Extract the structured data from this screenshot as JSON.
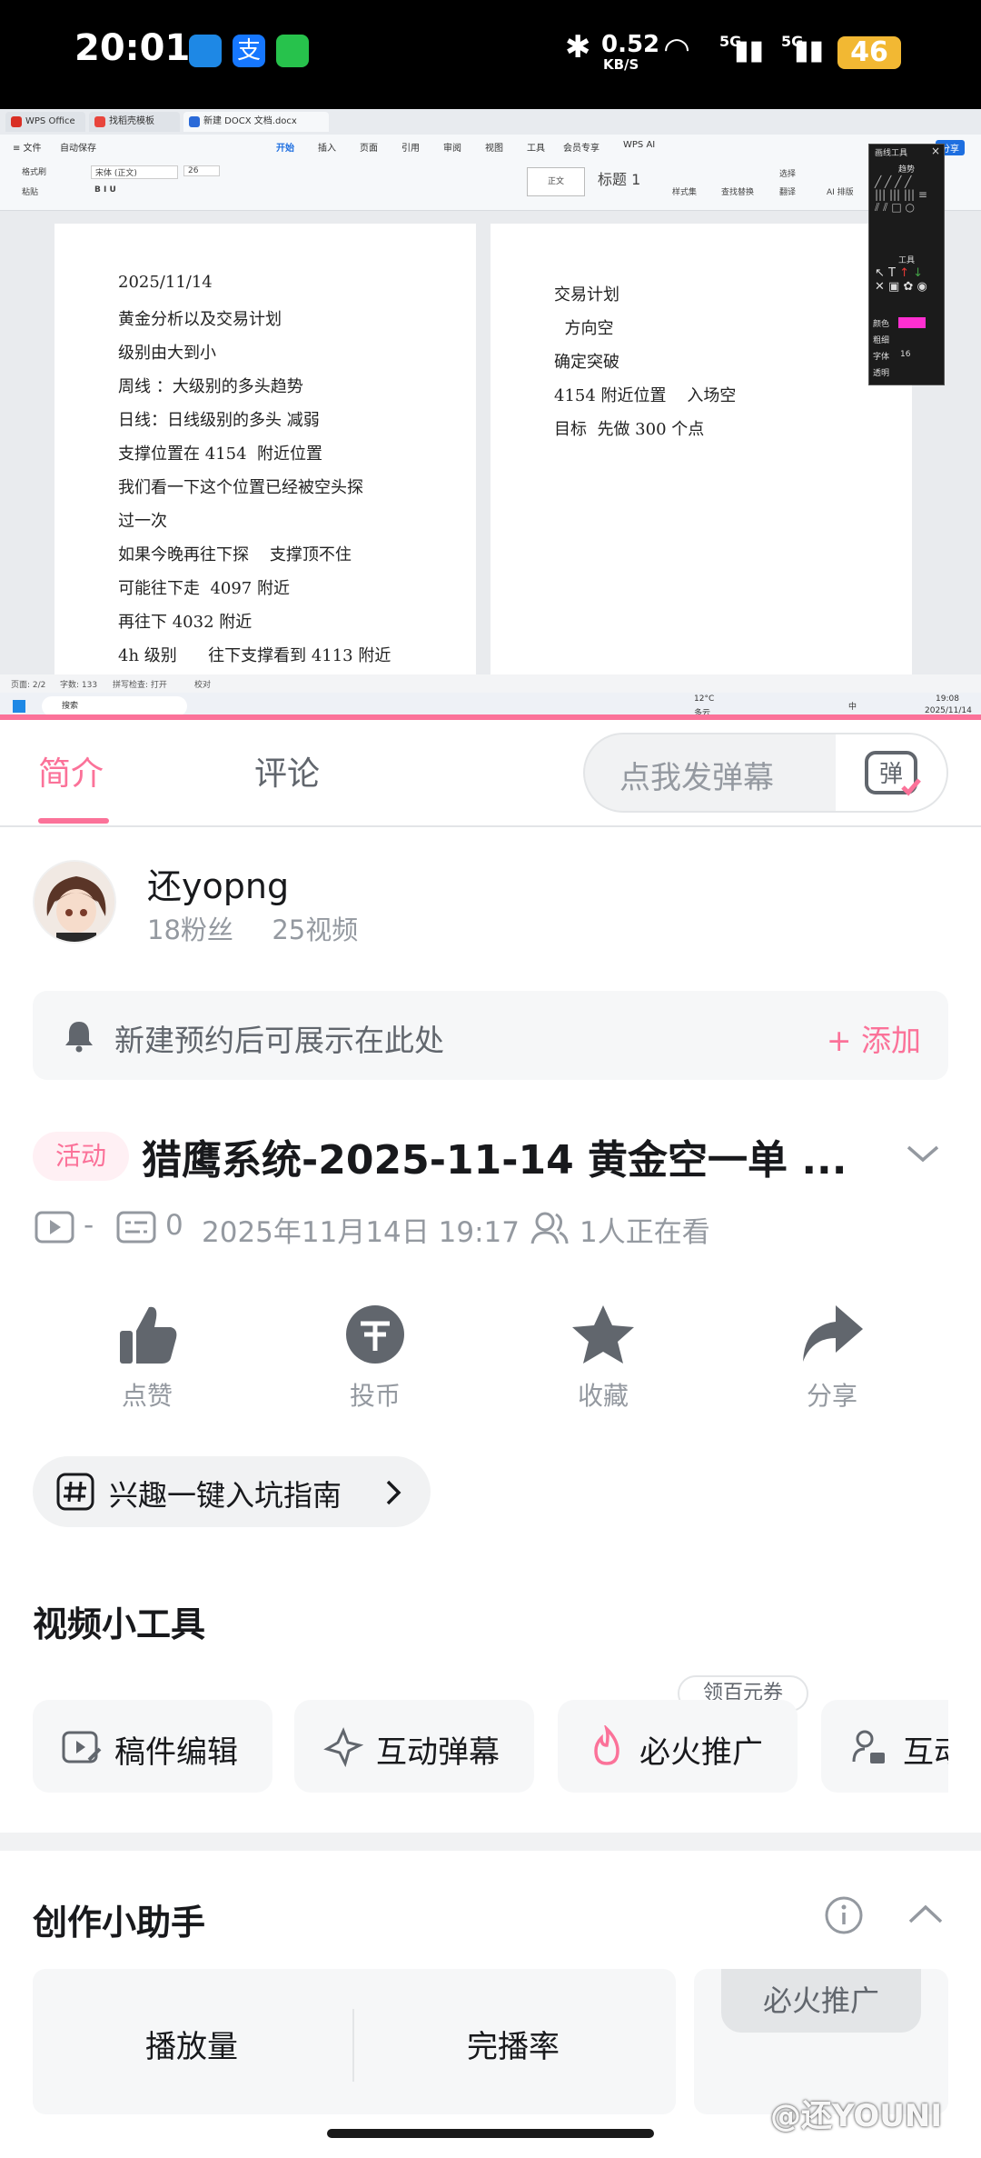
{
  "status_bar": {
    "time": "20:01",
    "net_speed_value": "0.52",
    "net_speed_unit": "KB/S",
    "signal1": "5G",
    "signal2": "5G",
    "battery": "46"
  },
  "wps": {
    "tabs": [
      "WPS Office",
      "找稻壳模板",
      "新建 DOCX 文档.docx"
    ],
    "menu_left": [
      "≡ 文件",
      "自动保存"
    ],
    "menu": [
      "开始",
      "插入",
      "页面",
      "引用",
      "审阅",
      "视图",
      "工具",
      "会员专享",
      "WPS AI"
    ],
    "share": "分享",
    "ribbon": {
      "format_painter": "格式刷",
      "paste": "粘贴",
      "font": "宋体 (正文)",
      "size": "26",
      "style_normal": "正文",
      "style_h1": "标题 1",
      "styles": "样式集",
      "find": "查找替换",
      "select": "选择",
      "translate": "翻译",
      "ai_layout": "AI 排版"
    },
    "page1_lines": [
      "2025/11/14",
      "黄金分析以及交易计划",
      "级别由大到小",
      "周线 ：大级别的多头趋势",
      "日线：日线级别的多头 减弱",
      "支撑位置在 4154  附近位置",
      "我们看一下这个位置已经被空头探",
      "过一次",
      "如果今晚再往下探    支撑顶不住",
      "可能往下走  4097 附近",
      "再往下 4032 附近",
      "4h 级别      往下支撑看到 4113 附近"
    ],
    "page2_lines": [
      "交易计划",
      "  方向空",
      "确定突破",
      "4154 附近位置    入场空",
      "目标  先做 300 个点"
    ],
    "status": {
      "page": "页面: 2/2",
      "words": "字数: 133",
      "spell": "拼写检查: 打开",
      "proof": "校对"
    },
    "taskbar": {
      "search": "搜索",
      "weather_temp": "12°C",
      "weather_desc": "多云",
      "ime": "中",
      "clock_time": "19:08",
      "clock_date": "2025/11/14"
    },
    "pen_panel": {
      "title": "画线工具",
      "trend": "趋势",
      "tools": "工具",
      "color": "颜色",
      "thickness": "粗细",
      "font": "字体",
      "font_size": "16",
      "opacity": "透明"
    }
  },
  "tabs": {
    "intro": "简介",
    "comments": "评论",
    "danmaku_placeholder": "点我发弹幕",
    "danmaku_icon_char": "弹"
  },
  "uploader": {
    "name": "还yopng",
    "fans": "18粉丝",
    "videos": "25视频"
  },
  "reserve": {
    "text": "新建预约后可展示在此处",
    "add": "+ 添加"
  },
  "video": {
    "tag": "活动",
    "title": "猎鹰系统-2025-11-14 黄金空一单  ...",
    "plays": "-",
    "danmaku_count": "0",
    "date": "2025年11月14日 19:17",
    "watching": "1人正在看"
  },
  "actions": [
    "点赞",
    "投币",
    "收藏",
    "分享"
  ],
  "interest": {
    "text": "兴趣一键入坑指南"
  },
  "tools": {
    "title": "视频小工具",
    "coupon": "领百元券",
    "items": [
      "稿件编辑",
      "互动弹幕",
      "必火推广",
      "互动"
    ]
  },
  "assistant": {
    "title": "创作小助手",
    "stats": [
      "播放量",
      "完播率"
    ],
    "promo": "必火推广"
  },
  "watermark": "@还YOUNI",
  "colors": {
    "accent": "#fb7299",
    "text": "#18191c",
    "secondary": "#9499a0"
  }
}
